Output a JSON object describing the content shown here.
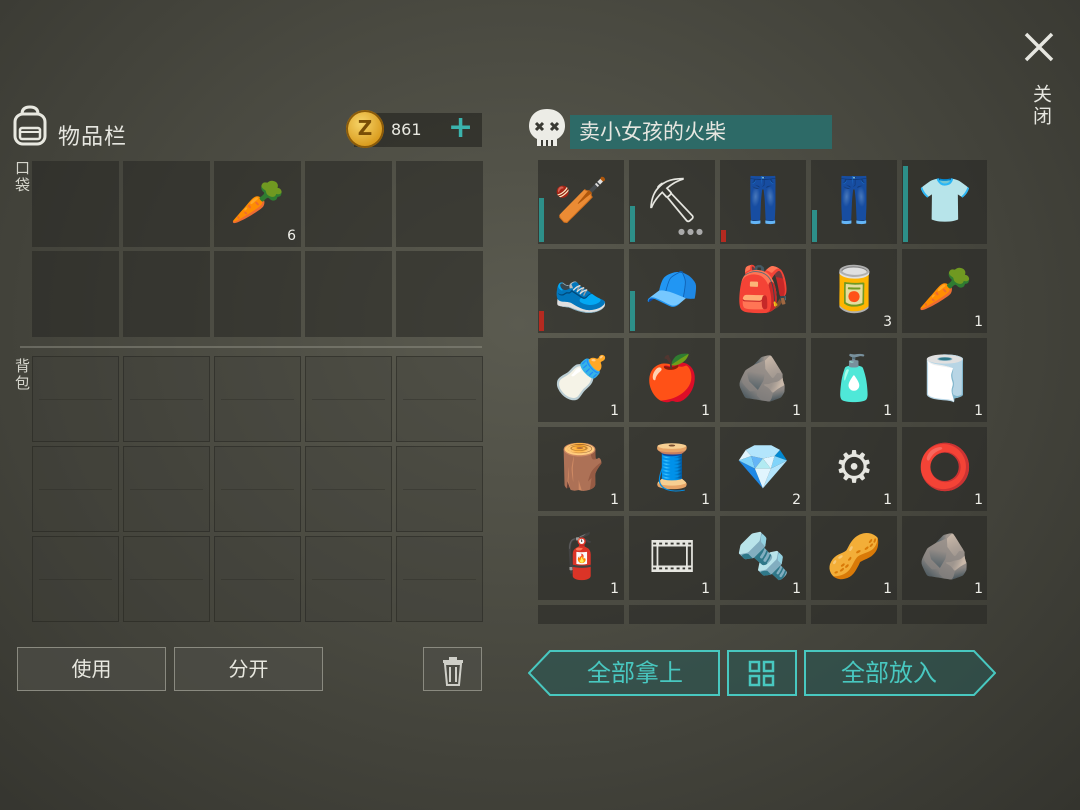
{
  "inventory": {
    "title": "物品栏",
    "coins": "861",
    "coin_symbol": "Z",
    "add_symbol": "+",
    "pocket_label": "口袋",
    "backpack_label": "背包",
    "pocket_slots": [
      {
        "icon": "",
        "qty": ""
      },
      {
        "icon": "",
        "qty": ""
      },
      {
        "icon": "🥕",
        "name": "carrot-icon",
        "qty": "6"
      },
      {
        "icon": "",
        "qty": ""
      },
      {
        "icon": "",
        "qty": ""
      },
      {
        "icon": "",
        "qty": ""
      },
      {
        "icon": "",
        "qty": ""
      },
      {
        "icon": "",
        "qty": ""
      },
      {
        "icon": "",
        "qty": ""
      },
      {
        "icon": "",
        "qty": ""
      }
    ],
    "backpack_slots": 15,
    "use_label": "使用",
    "split_label": "分开",
    "trash_icon": "trash-icon"
  },
  "loot": {
    "name": "卖小女孩的火柴",
    "close_label": "关闭",
    "take_all_label": "全部拿上",
    "put_all_label": "全部放入",
    "sort_icon": "grid-sort-icon",
    "slots": [
      {
        "icon": "🏏",
        "name": "spiked-club-icon",
        "qty": "",
        "dur": 0.55,
        "durColor": "teal"
      },
      {
        "icon": "⛏",
        "name": "pickaxe-icon",
        "qty": "",
        "dur": 0.45,
        "durColor": "teal",
        "dots": true
      },
      {
        "icon": "👖",
        "name": "camo-pants-icon",
        "qty": "",
        "dur": 0.15,
        "durColor": "red"
      },
      {
        "icon": "👖",
        "name": "brown-pants-icon",
        "qty": "",
        "dur": 0.4,
        "durColor": "teal"
      },
      {
        "icon": "👕",
        "name": "denim-shirt-icon",
        "qty": "",
        "dur": 0.95,
        "durColor": "teal"
      },
      {
        "icon": "👟",
        "name": "sneakers-icon",
        "qty": "",
        "dur": 0.25,
        "durColor": "red"
      },
      {
        "icon": "🧢",
        "name": "cap-icon",
        "qty": "",
        "dur": 0.5,
        "durColor": "teal"
      },
      {
        "icon": "🎒",
        "name": "backpack-icon",
        "qty": ""
      },
      {
        "icon": "🥫",
        "name": "beer-can-icon",
        "qty": "3"
      },
      {
        "icon": "🥕",
        "name": "carrot-icon",
        "qty": "1"
      },
      {
        "icon": "🍼",
        "name": "water-bottle-icon",
        "qty": "1"
      },
      {
        "icon": "🍎",
        "name": "apples-icon",
        "qty": "1"
      },
      {
        "icon": "🪨",
        "name": "coal-icon",
        "qty": "1"
      },
      {
        "icon": "🧴",
        "name": "spirit-bottle-icon",
        "qty": "1"
      },
      {
        "icon": "🧻",
        "name": "cloth-icon",
        "qty": "1"
      },
      {
        "icon": "🪵",
        "name": "plank-icon",
        "qty": "1"
      },
      {
        "icon": "🧵",
        "name": "wire-spool-icon",
        "qty": "1"
      },
      {
        "icon": "💎",
        "name": "christmas-lights-icon",
        "qty": "2"
      },
      {
        "icon": "⚙",
        "name": "bearing-icon",
        "qty": "1"
      },
      {
        "icon": "⭕",
        "name": "rubber-seal-icon",
        "qty": "1"
      },
      {
        "icon": "🧯",
        "name": "spray-paint-icon",
        "qty": "1"
      },
      {
        "icon": "🎞",
        "name": "blue-tape-icon",
        "qty": "1"
      },
      {
        "icon": "🔩",
        "name": "scrap-metal-icon",
        "qty": "1"
      },
      {
        "icon": "🥜",
        "name": "nuts-icon",
        "qty": "1"
      },
      {
        "icon": "🪨",
        "name": "stone-icon",
        "qty": "1"
      },
      {
        "icon": "",
        "name": "partial-slot-icon",
        "qty": ""
      },
      {
        "icon": "",
        "name": "partial-slot-icon",
        "qty": ""
      },
      {
        "icon": "",
        "name": "partial-slot-icon",
        "qty": ""
      },
      {
        "icon": "",
        "name": "partial-slot-icon",
        "qty": ""
      },
      {
        "icon": "",
        "name": "partial-slot-icon",
        "qty": ""
      }
    ]
  },
  "colors": {
    "accent": "#48c8c0",
    "name_bar": "#2d6a67",
    "durability_teal": "#2d8f89",
    "durability_red": "#b42a20",
    "coin": "#e0a422"
  }
}
